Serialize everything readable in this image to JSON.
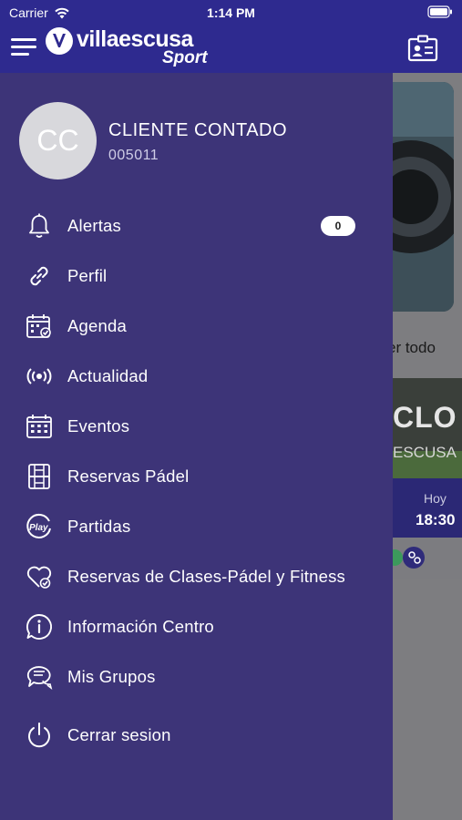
{
  "status_bar": {
    "carrier": "Carrier",
    "time": "1:14 PM"
  },
  "header": {
    "brand_name": "villaescusa",
    "brand_sub": "Sport"
  },
  "drawer": {
    "avatar_initials": "CC",
    "user_name": "CLIENTE CONTADO",
    "user_code": "005011",
    "items": [
      {
        "label": "Alertas",
        "icon": "bell-icon",
        "badge": "0"
      },
      {
        "label": "Perfil",
        "icon": "link-icon"
      },
      {
        "label": "Agenda",
        "icon": "calendar-check-icon"
      },
      {
        "label": "Actualidad",
        "icon": "broadcast-icon"
      },
      {
        "label": "Eventos",
        "icon": "calendar-grid-icon"
      },
      {
        "label": "Reservas Pádel",
        "icon": "padel-court-icon"
      },
      {
        "label": "Partidas",
        "icon": "play-badge-icon"
      },
      {
        "label": "Reservas de Clases-Pádel y Fitness",
        "icon": "heart-check-icon"
      },
      {
        "label": "Información Centro",
        "icon": "info-bubble-icon"
      },
      {
        "label": "Mis Grupos",
        "icon": "group-chat-icon"
      },
      {
        "label": "Cerrar sesion",
        "icon": "power-icon"
      }
    ]
  },
  "background": {
    "see_all": "er todo",
    "card_title": "CLO I",
    "card_subtitle": "ESCUSA",
    "day": "Hoy",
    "hour": "18:30"
  },
  "colors": {
    "header": "#2e2a8f",
    "drawer": "#3d3478",
    "badge": "#ffffff"
  }
}
